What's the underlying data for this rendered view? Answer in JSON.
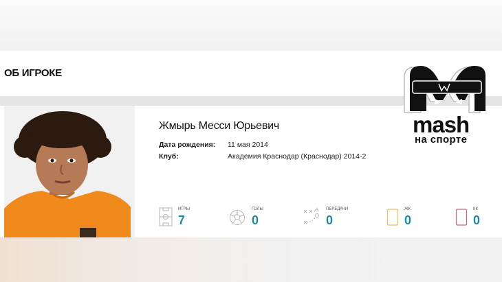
{
  "section": {
    "title": "ОБ ИГРОКЕ"
  },
  "player": {
    "name": "Жмырь Месси Юрьевич",
    "birth_label": "Дата рождения:",
    "birth_value": "11 мая 2014",
    "club_label": "Клуб:",
    "club_value": "Академия Краснодар (Краснодар) 2014-2"
  },
  "stats": [
    {
      "label": "игры",
      "value": "7",
      "icon": "pitch-icon"
    },
    {
      "label": "голы",
      "value": "0",
      "icon": "ball-icon"
    },
    {
      "label": "передачи",
      "value": "0",
      "icon": "tactics-icon"
    },
    {
      "label": "жк",
      "value": "0",
      "icon": "yellow-card-icon"
    },
    {
      "label": "кк",
      "value": "0",
      "icon": "red-card-icon"
    }
  ],
  "logo": {
    "word": "mash",
    "sub": "на спорте"
  },
  "colors": {
    "accent": "#1d8aa3",
    "yellow_card": "#e8c25a",
    "red_card": "#d8627a",
    "shirt": "#f08a1c"
  }
}
